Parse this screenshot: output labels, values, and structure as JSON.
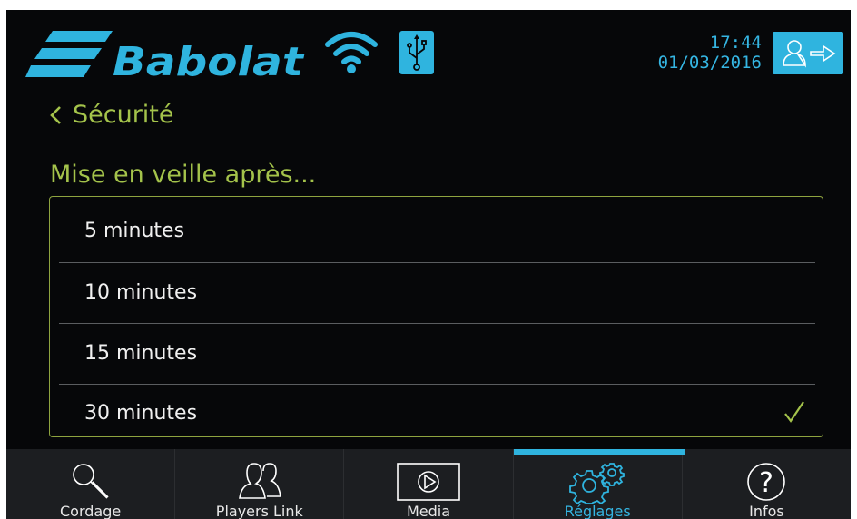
{
  "header": {
    "brand": "Babolat",
    "time": "17:44",
    "date": "01/03/2016",
    "icons": [
      "babolat-logo",
      "wifi-icon",
      "usb-icon",
      "logout-icon"
    ]
  },
  "page": {
    "back_label": "Sécurité",
    "section_title": "Mise en veille après..."
  },
  "options": [
    {
      "label": "5 minutes",
      "selected": false
    },
    {
      "label": "10 minutes",
      "selected": false
    },
    {
      "label": "15 minutes",
      "selected": false
    },
    {
      "label": "30 minutes",
      "selected": true
    }
  ],
  "nav": {
    "items": [
      {
        "label": "Cordage",
        "icon": "racket-icon",
        "active": false
      },
      {
        "label": "Players Link",
        "icon": "players-icon",
        "active": false
      },
      {
        "label": "Media",
        "icon": "play-icon",
        "active": false
      },
      {
        "label": "Réglages",
        "icon": "gears-icon",
        "active": true
      },
      {
        "label": "Infos",
        "icon": "help-icon",
        "active": false
      }
    ]
  },
  "colors": {
    "background": "#060709",
    "accent_blue": "#2fb4df",
    "accent_green": "#a4c34b",
    "nav_background": "#1c1e21"
  }
}
